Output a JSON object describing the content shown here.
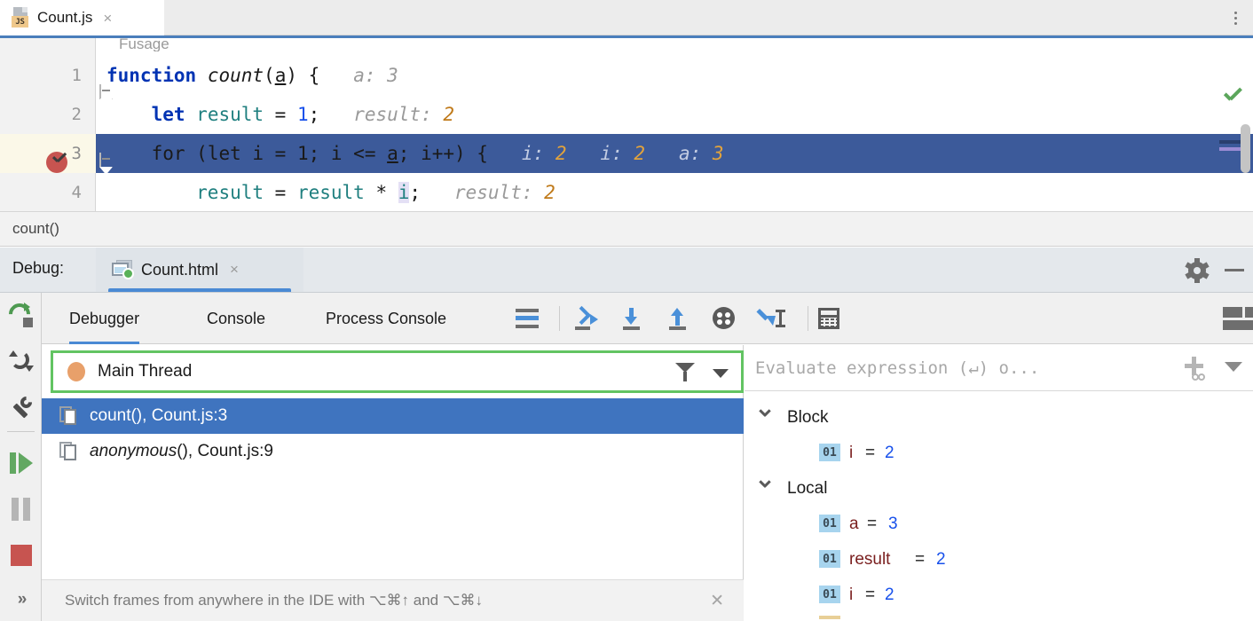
{
  "window": {
    "menu_icon": "kebab-menu-icon"
  },
  "editor_tab": {
    "filename": "Count.js",
    "file_type_badge": "JS",
    "close_label": "×"
  },
  "editor": {
    "ghost_breadcrumb": "Fusage",
    "lines": [
      {
        "number": "1",
        "tokens": [
          {
            "t": "function",
            "c": "kw"
          },
          {
            "t": " ",
            "c": "plain"
          },
          {
            "t": "count",
            "c": "fn"
          },
          {
            "t": "(",
            "c": "plain"
          },
          {
            "t": "a",
            "c": "plain ul"
          },
          {
            "t": ") {",
            "c": "plain"
          }
        ],
        "inline_hint_name": "a:",
        "inline_hint_value": "3",
        "hint_value_gray": true,
        "current": false,
        "breakpoint": false,
        "fold": true
      },
      {
        "number": "2",
        "tokens": [
          {
            "t": "    ",
            "c": "plain"
          },
          {
            "t": "let",
            "c": "kw"
          },
          {
            "t": " ",
            "c": "plain"
          },
          {
            "t": "result",
            "c": "var"
          },
          {
            "t": " = ",
            "c": "plain"
          },
          {
            "t": "1",
            "c": "num"
          },
          {
            "t": ";",
            "c": "plain"
          }
        ],
        "inline_hint_name": "result:",
        "inline_hint_value": "2",
        "hint_value_gray": false,
        "current": false,
        "breakpoint": false,
        "fold": false
      },
      {
        "number": "3",
        "tokens": [
          {
            "t": "    ",
            "c": "plain"
          },
          {
            "t": "for",
            "c": "plain"
          },
          {
            "t": " (",
            "c": "plain"
          },
          {
            "t": "let",
            "c": "plain"
          },
          {
            "t": " i = 1; i <= ",
            "c": "plain"
          },
          {
            "t": "a",
            "c": "plain ul"
          },
          {
            "t": "; i++) {",
            "c": "plain"
          }
        ],
        "hints_multi": [
          {
            "name": "i:",
            "value": "2"
          },
          {
            "name": "i:",
            "value": "2"
          },
          {
            "name": "a:",
            "value": "3"
          }
        ],
        "current": true,
        "breakpoint": true,
        "fold": true
      },
      {
        "number": "4",
        "tokens": [
          {
            "t": "        ",
            "c": "plain"
          },
          {
            "t": "result",
            "c": "var"
          },
          {
            "t": " = ",
            "c": "plain"
          },
          {
            "t": "result",
            "c": "var"
          },
          {
            "t": " * ",
            "c": "plain"
          },
          {
            "t": "i",
            "c": "var hl-i"
          },
          {
            "t": ";",
            "c": "plain"
          }
        ],
        "inline_hint_name": "result:",
        "inline_hint_value": "2",
        "hint_value_gray": false,
        "current": false,
        "breakpoint": false,
        "fold": false
      }
    ],
    "inspection_status": "ok-check-icon"
  },
  "breadcrumb": {
    "text": "count()"
  },
  "debug_header": {
    "label": "Debug:",
    "session_tab": "Count.html",
    "session_close": "×",
    "settings_icon": "gear-icon",
    "minimize_icon": "minimize-icon"
  },
  "rail": {
    "buttons": [
      {
        "name": "rerun-button",
        "icon": "rerun-icon"
      },
      {
        "name": "restart-frame-button",
        "icon": "restart-icon"
      },
      {
        "name": "debug-settings-button",
        "icon": "wrench-icon"
      },
      {
        "name": "resume-program-button",
        "icon": "resume-icon"
      },
      {
        "name": "pause-program-button",
        "icon": "pause-icon"
      },
      {
        "name": "stop-button",
        "icon": "stop-icon"
      },
      {
        "name": "more-actions-button",
        "icon": "chevrons-right-icon",
        "glyph": "»"
      }
    ]
  },
  "debugger_tabs": [
    {
      "label": "Debugger",
      "active": true
    },
    {
      "label": "Console",
      "active": false
    },
    {
      "label": "Process Console",
      "active": false
    }
  ],
  "debugger_toolbar_icons": [
    {
      "name": "show-frames-icon"
    },
    {
      "name": "step-over-icon"
    },
    {
      "name": "step-into-icon"
    },
    {
      "name": "step-out-icon"
    },
    {
      "name": "force-step-into-icon"
    },
    {
      "name": "run-to-cursor-icon"
    },
    {
      "name": "evaluate-expression-icon"
    },
    {
      "name": "layout-settings-icon"
    }
  ],
  "frames": {
    "thread": {
      "name": "Main Thread",
      "status_dot_color": "#e8a06a",
      "filter_icon": "filter-icon",
      "dropdown_icon": "chevron-down-icon",
      "focus_border_color": "#62c462"
    },
    "rows": [
      {
        "fn": "count()",
        "rest": ", Count.js:3",
        "italic": false,
        "selected": true
      },
      {
        "fn": "anonymous",
        "rest": "(), Count.js:9",
        "italic": true,
        "selected": false
      }
    ],
    "hint": "Switch frames from anywhere in the IDE with ⌥⌘↑ and ⌥⌘↓",
    "hint_close": "✕"
  },
  "variables": {
    "evaluate_placeholder": "Evaluate expression (↵) o...",
    "add_watch_icon": "add-watch-icon",
    "dropdown_icon": "chevron-down-icon",
    "groups": [
      {
        "label": "Block",
        "expanded": true,
        "items": [
          {
            "badge": "01",
            "name": "i",
            "eq": "=",
            "value": "2"
          }
        ]
      },
      {
        "label": "Local",
        "expanded": true,
        "items": [
          {
            "badge": "01",
            "name": "a",
            "eq": "=",
            "value": "3"
          },
          {
            "badge": "01",
            "name": "result",
            "eq": "=",
            "value": "2"
          },
          {
            "badge": "01",
            "name": "i",
            "eq": "=",
            "value": "2"
          }
        ]
      }
    ]
  },
  "colors": {
    "current_line": "#3c5a9a",
    "selection": "#3f74bf",
    "accent_blue": "#4a8ad4",
    "breakpoint_red": "#c75450",
    "value_blue": "#1750eb",
    "name_red": "#7a1f1f",
    "hint_orange": "#c07a1a"
  }
}
